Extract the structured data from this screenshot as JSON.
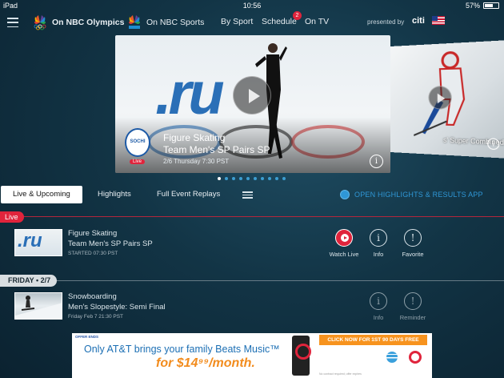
{
  "status_bar": {
    "device": "iPad",
    "time": "10:56",
    "battery": "57%"
  },
  "nav": {
    "olympics": "On NBC Olympics",
    "sports": "On NBC Sports",
    "by_sport": "By Sport",
    "schedule": "Schedule",
    "schedule_badge": "2",
    "on_tv": "On TV",
    "presented_by": "presented by",
    "sponsor": "citi"
  },
  "hero": {
    "sport": "Figure Skating",
    "event": "Team Men's SP Pairs SP",
    "date": "2/6 Thursday 7:30 PST",
    "live_tag": "Live",
    "logo_text": "SOCHI",
    "next_card_label": "s' Super Combined 1"
  },
  "carousel": {
    "total_dots": 10,
    "active_index": 0
  },
  "tabs": {
    "live_upcoming": "Live & Upcoming",
    "highlights": "Highlights",
    "full_replays": "Full Event Replays",
    "open_highlights": "OPEN HIGHLIGHTS & RESULTS APP"
  },
  "sections": {
    "live": "Live",
    "day": "FRIDAY • 2/7"
  },
  "events": [
    {
      "sport": "Figure Skating",
      "event": "Team Men's SP Pairs SP",
      "time": "STARTED 07:30 PST",
      "actions": [
        "Watch Live",
        "Info",
        "Favorite"
      ]
    },
    {
      "sport": "Snowboarding",
      "event": "Men's Slopestyle: Semi Final",
      "time": "Friday Feb 7 21:30 PST",
      "actions": [
        "Info",
        "Reminder"
      ]
    }
  ],
  "ad": {
    "tag": "OFFER ENDS",
    "line1": "Only AT&T brings your family Beats Music™",
    "line2": "for $14⁹⁹/month.",
    "cta": "CLICK NOW FOR 1ST 90 DAYS FREE",
    "fine_print": "No contract required; offer expires"
  },
  "colors": {
    "accent": "#e0243c",
    "link": "#2f97d6",
    "background": "#123445"
  }
}
